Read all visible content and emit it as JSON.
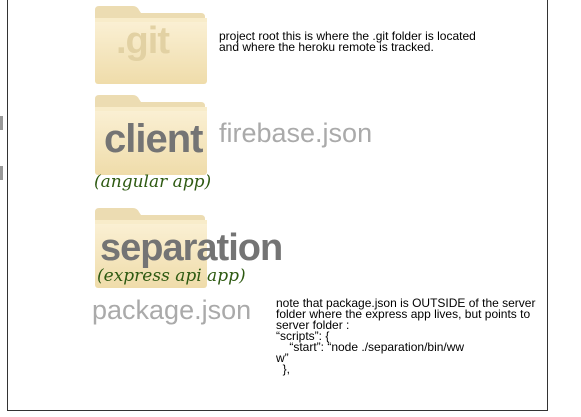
{
  "folders": {
    "git": {
      "label": ".git",
      "note_lines": [
        "project root this is where the .git folder is located",
        "and where the heroku remote is tracked."
      ]
    },
    "client": {
      "label": "client",
      "sub": "(angular app)",
      "file": "firebase.json"
    },
    "separation": {
      "label": "separation",
      "sub": "(express api app)"
    }
  },
  "package": {
    "file": "package.json",
    "note_lines": [
      "note that package.json is OUTSIDE of the server",
      "folder where the express app lives, but points to",
      "server folder :",
      "“scripts”: {",
      "    “start”: “node ./separation/bin/ww",
      "w”",
      "  },"
    ]
  },
  "colors": {
    "folder_body": "#f6e8c4",
    "folder_tab": "#ecdcb2",
    "git_label": "#e2d1a3",
    "dark_label": "#747474",
    "sub_label": "#2e5a12",
    "file_label": "#aaaaaa"
  }
}
